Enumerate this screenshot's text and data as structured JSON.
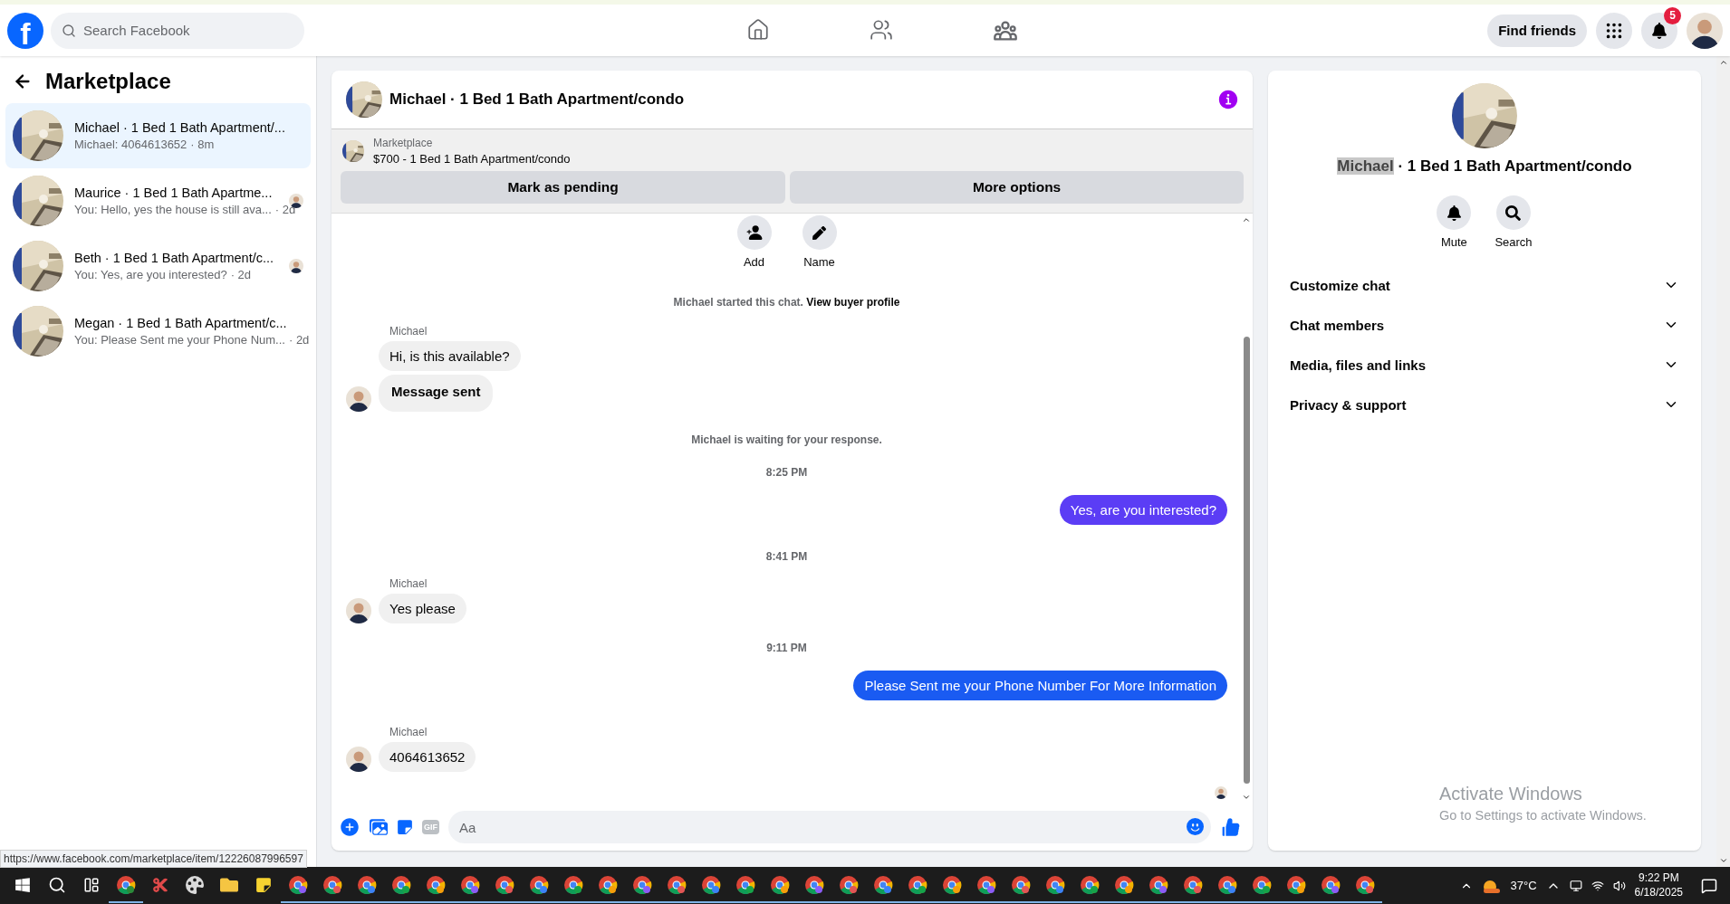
{
  "top_bar": {
    "logo_letter": "f",
    "search": {
      "placeholder": "Search Facebook"
    },
    "find_friends": "Find friends",
    "notification_count": "5"
  },
  "sidebar": {
    "title": "Marketplace",
    "conversations": [
      {
        "title": "Michael · 1 Bed 1 Bath Apartment/...",
        "preview": "Michael: 4064613652",
        "time": "· 8m",
        "selected": true,
        "seen": false
      },
      {
        "title": "Maurice · 1 Bed 1 Bath Apartme...",
        "preview": "You: Hello, yes the house is still ava...",
        "time": "· 2d",
        "selected": false,
        "seen": true
      },
      {
        "title": "Beth · 1 Bed 1 Bath Apartment/c...",
        "preview": "You: Yes, are you interested?",
        "time": "· 2d",
        "selected": false,
        "seen": true
      },
      {
        "title": "Megan · 1 Bed 1 Bath Apartment/c...",
        "preview": "You: Please Sent me your Phone Num...",
        "time": "· 2d",
        "selected": false,
        "seen": false
      }
    ]
  },
  "chat": {
    "title": "Michael · 1 Bed 1 Bath Apartment/condo",
    "listing": {
      "label": "Marketplace",
      "title": "$700 - 1 Bed 1 Bath Apartment/condo"
    },
    "actions": [
      "Mark as pending",
      "More options"
    ],
    "quick_actions": [
      {
        "kind": "add",
        "label": "Add"
      },
      {
        "kind": "rename",
        "label": "Name"
      }
    ],
    "messages": [
      {
        "kind": "notice",
        "text": "Michael started this chat.",
        "link": "View buyer profile"
      },
      {
        "kind": "incoming",
        "sender": "Michael",
        "bubbles": [
          {
            "text": "Hi, is this available?",
            "bold": false
          },
          {
            "text": "Message sent",
            "bold": true
          }
        ]
      },
      {
        "kind": "notice",
        "text": "Michael is waiting for your response."
      },
      {
        "kind": "time",
        "text": "8:25 PM"
      },
      {
        "kind": "outgoing",
        "text": "Yes, are you interested?",
        "color": "#5b3df5"
      },
      {
        "kind": "time",
        "text": "8:41 PM"
      },
      {
        "kind": "incoming",
        "sender": "Michael",
        "bubbles": [
          {
            "text": "Yes please",
            "bold": false
          }
        ]
      },
      {
        "kind": "time",
        "text": "9:11 PM"
      },
      {
        "kind": "outgoing",
        "text": "Please Sent me your Phone Number For More Information",
        "color": "#1a5bf2"
      },
      {
        "kind": "incoming",
        "sender": "Michael",
        "bubbles": [
          {
            "text": "4064613652",
            "bold": false
          }
        ]
      }
    ],
    "composer": {
      "placeholder": "Aa",
      "gif_label": "GIF"
    }
  },
  "details": {
    "name": "Michael",
    "name_highlighted": true,
    "rest": "· 1 Bed 1 Bath Apartment/condo",
    "actions": [
      {
        "kind": "mute",
        "label": "Mute"
      },
      {
        "kind": "search",
        "label": "Search"
      }
    ],
    "sections": [
      {
        "label": "Customize chat",
        "expanded": false
      },
      {
        "label": "Chat members",
        "expanded": false
      },
      {
        "label": "Media, files and links",
        "expanded": false
      },
      {
        "label": "Privacy & support",
        "expanded": false
      }
    ]
  },
  "status_url": "https://www.facebook.com/marketplace/item/12226087996597",
  "activation": {
    "title": "Activate Windows",
    "hint": "Go to Settings to activate Windows."
  },
  "taskbar": {
    "temperature": "37°C",
    "time": "9:22 PM",
    "date": "6/18/2025"
  }
}
